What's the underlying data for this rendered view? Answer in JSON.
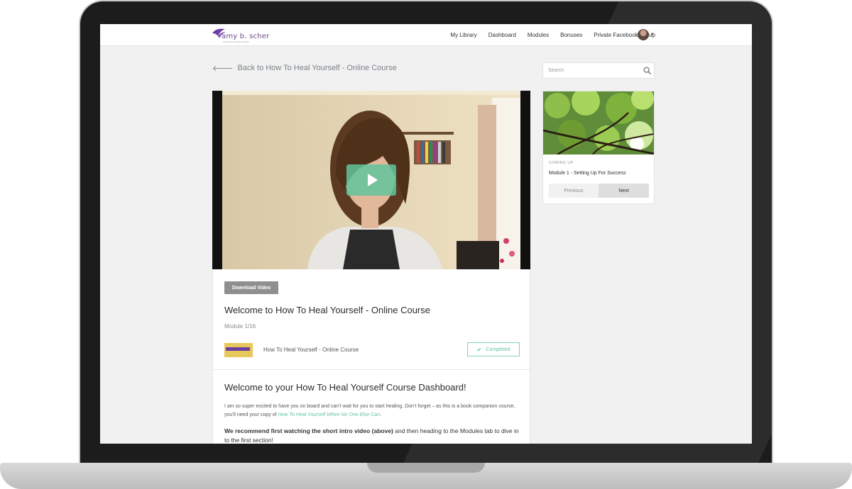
{
  "header": {
    "logo_text": "amy b. scher",
    "logo_subtitle": "author and energy therapist",
    "nav": [
      "My Library",
      "Dashboard",
      "Modules",
      "Bonuses",
      "Private Facebook Group"
    ]
  },
  "back_link": "Back to How To Heal Yourself - Online Course",
  "search": {
    "placeholder": "Search"
  },
  "lesson": {
    "download_label": "Download Video",
    "title": "Welcome to How To Heal Yourself - Online Course",
    "module": "Module 1/16",
    "course_name": "How To Heal Yourself - Online Course",
    "completed_label": "Completed"
  },
  "content": {
    "heading": "Welcome to your How To Heal Yourself Course Dashboard!",
    "para1_before": "I am so super excited to have you on board and can’t wait for you to start healing. Don’t forget – as this is a book companion course, you’ll need your copy of ",
    "para1_link": "How To Heal Yourself When No One Else Can",
    "para1_after": ".",
    "para2_bold": "We recommend first watching the short intro video (above)",
    "para2_rest": " and then heading to the Modules tab to dive in to the first section!"
  },
  "up_next": {
    "label": "COMING UP",
    "title": "Module 1 - Setting Up For Success",
    "prev_label": "Previous",
    "next_label": "Next"
  },
  "colors": {
    "accent": "#61c39e",
    "brand_purple": "#6a3fa0",
    "download_btn": "#8f8f8f"
  }
}
